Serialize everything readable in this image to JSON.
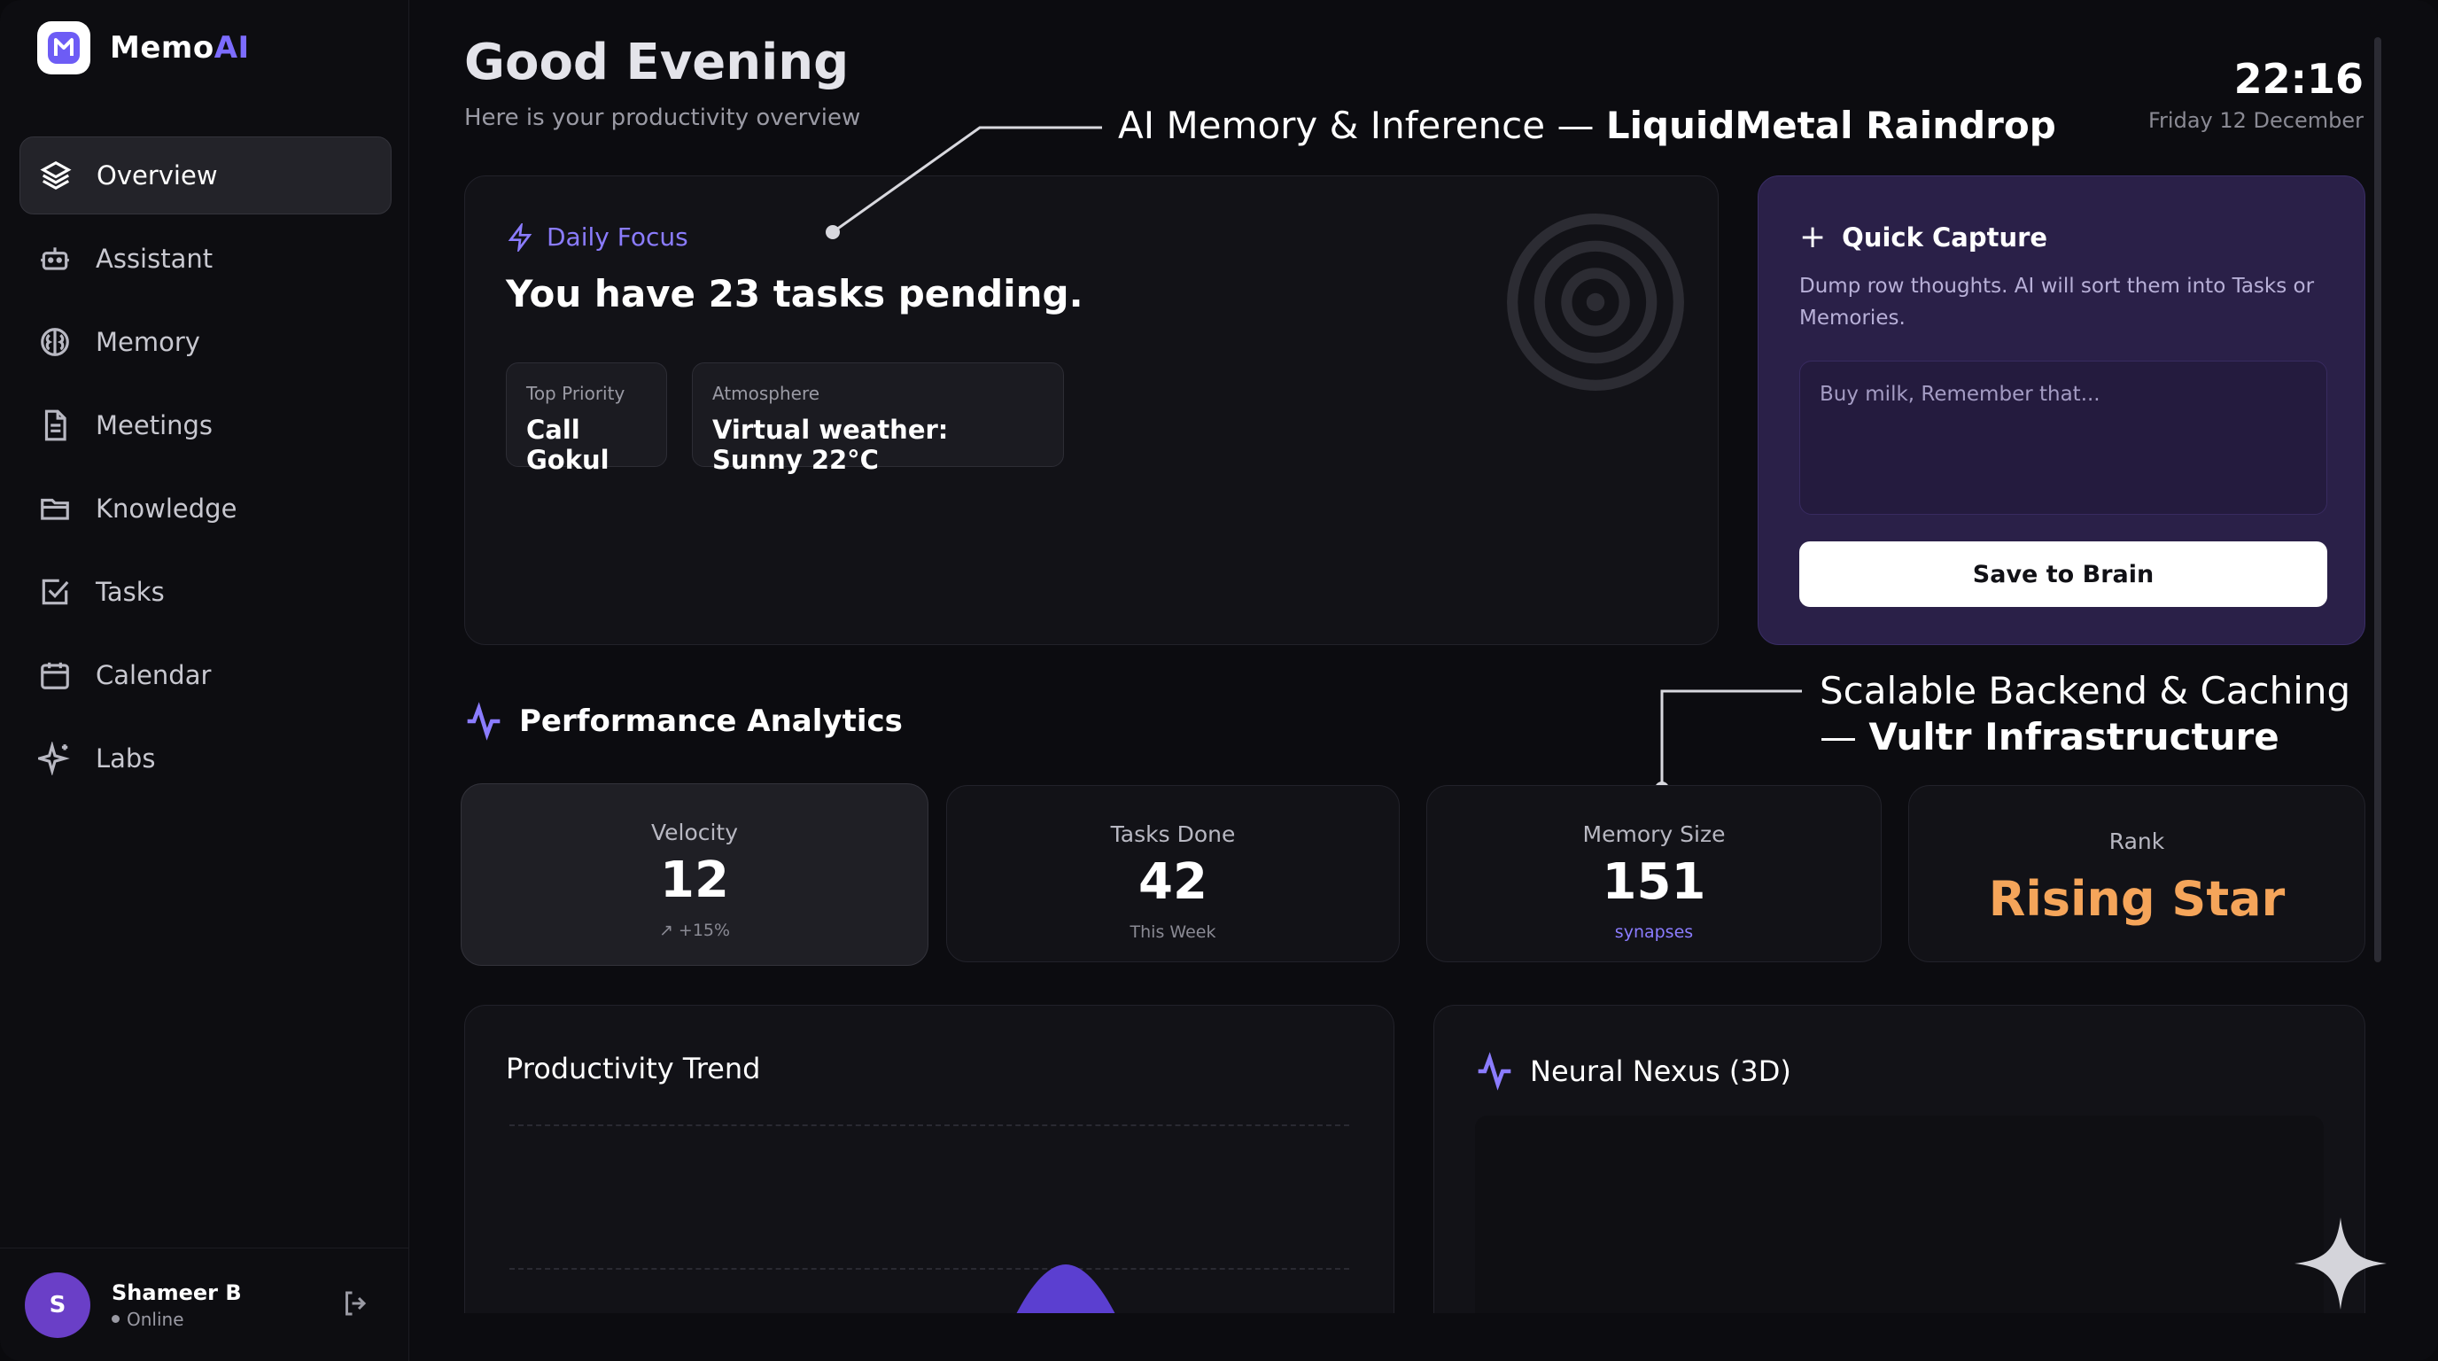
{
  "brand": {
    "name_main": "Memo",
    "name_accent": "AI"
  },
  "nav": {
    "items": [
      {
        "label": "Overview",
        "icon": "layers-icon",
        "active": true
      },
      {
        "label": "Assistant",
        "icon": "robot-icon"
      },
      {
        "label": "Memory",
        "icon": "brain-icon"
      },
      {
        "label": "Meetings",
        "icon": "document-icon"
      },
      {
        "label": "Knowledge",
        "icon": "folder-icon"
      },
      {
        "label": "Tasks",
        "icon": "checkbox-icon"
      },
      {
        "label": "Calendar",
        "icon": "calendar-icon"
      },
      {
        "label": "Labs",
        "icon": "sparkles-icon"
      }
    ]
  },
  "user": {
    "initial": "S",
    "name": "Shameer B",
    "status": "Online"
  },
  "header": {
    "greeting": "Good Evening",
    "subtitle": "Here is your productivity overview",
    "time": "22:16",
    "date": "Friday 12 December"
  },
  "annotations": {
    "top": {
      "prefix": "AI Memory & Inference — ",
      "bold": "LiquidMetal Raindrop"
    },
    "middle": {
      "line1": "Scalable Backend & Caching",
      "line2_prefix": "— ",
      "line2_bold": "Vultr Infrastructure"
    }
  },
  "focus": {
    "label": "Daily Focus",
    "title": "You have 23 tasks pending.",
    "top_priority_label": "Top Priority",
    "top_priority_value": "Call Gokul",
    "atmosphere_label": "Atmosphere",
    "atmosphere_value": "Virtual weather: Sunny 22°C"
  },
  "capture": {
    "title": "Quick Capture",
    "description": "Dump row thoughts. AI will sort them into Tasks or Memories.",
    "placeholder": "Buy milk, Remember that...",
    "button": "Save to Brain"
  },
  "analytics": {
    "title": "Performance Analytics",
    "velocity": {
      "label": "Velocity",
      "value": "12",
      "change": "↗ +15%"
    },
    "tasks_done": {
      "label": "Tasks Done",
      "value": "42",
      "sub": "This Week"
    },
    "memory_size": {
      "label": "Memory Size",
      "value": "151",
      "sub": "synapses"
    },
    "rank": {
      "label": "Rank",
      "value": "Rising Star"
    }
  },
  "panels": {
    "trend_title": "Productivity Trend",
    "nexus_title": "Neural Nexus (3D)"
  },
  "colors": {
    "accent": "#8b7cff",
    "rank": "#f5a55a",
    "capture_bg": "#2a2048"
  }
}
